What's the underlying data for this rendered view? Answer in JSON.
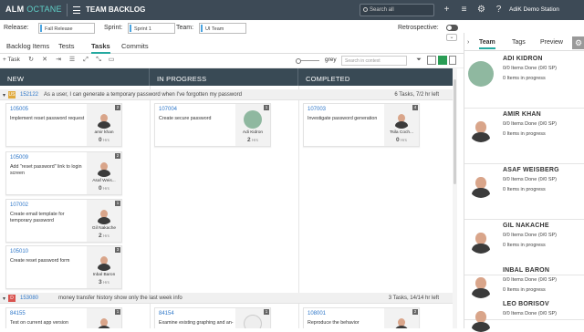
{
  "app": {
    "alm": "ALM",
    "octane": "OCTANE",
    "module": "TEAM BACKLOG",
    "search_placeholder": "Search all",
    "workspace": "AdiK Demo Station"
  },
  "filters": {
    "release_label": "Release:",
    "release_value": "Fall Release",
    "sprint_label": "Sprint:",
    "sprint_value": "Sprint 1",
    "team_label": "Team:",
    "team_value": "UI Team",
    "retro_label": "Retrospective:"
  },
  "tabs": [
    {
      "label": "Backlog Items"
    },
    {
      "label": "Tests"
    },
    {
      "label": "Tasks"
    },
    {
      "label": "Commits"
    }
  ],
  "toolbar": {
    "task_label": "Task",
    "grey_label": "grey",
    "filter_placeholder": "Search in context"
  },
  "columns": [
    {
      "title": "NEW"
    },
    {
      "title": "IN PROGRESS"
    },
    {
      "title": "COMPLETED"
    }
  ],
  "lanes": [
    {
      "badge": "US",
      "id": "152122",
      "desc": "As a user, I can generate a temporary password when I've forgotten my password",
      "tasks": "6 Tasks, 7/2 hr left"
    },
    {
      "badge": "D",
      "id": "153080",
      "desc": "money transfer history show only the last week info",
      "tasks": "3 Tasks, 14/14 hr left"
    }
  ],
  "cards": [
    {
      "id": "105005",
      "desc": "Implement reset password request",
      "num": "2",
      "owner": "amir khan",
      "hours": "0",
      "unit": "Hrs"
    },
    {
      "id": "105009",
      "desc": "Add \"reset password\" link to login screen",
      "num": "2",
      "owner": "Asaf Weis...",
      "hours": "0",
      "unit": "Hrs"
    },
    {
      "id": "107002",
      "desc": "Create email template for temporary password",
      "num": "1",
      "owner": "Gil Nakache",
      "hours": "2",
      "unit": "Hrs"
    },
    {
      "id": "105010",
      "desc": "Create reset password form",
      "num": "3",
      "owner": "Inbal Baron",
      "hours": "3",
      "unit": "Hrs"
    },
    {
      "id": "107004",
      "desc": "Create secure password",
      "num": "1",
      "owner": "Adi Kidron",
      "hours": "2",
      "unit": "Hrs"
    },
    {
      "id": "107003",
      "desc": "Investigate password generation",
      "num": "4",
      "owner": "Tsila Coch...",
      "hours": "0",
      "unit": "Hrs"
    },
    {
      "id": "84155",
      "desc": "Test on current app version",
      "num": "1",
      "owner": "",
      "hours": "",
      "unit": ""
    },
    {
      "id": "84154",
      "desc": "Examine existing graphing and an-",
      "num": "1",
      "owner": "",
      "hours": "",
      "unit": ""
    },
    {
      "id": "108001",
      "desc": "Reproduce the behavior",
      "num": "2",
      "owner": "",
      "hours": "",
      "unit": ""
    }
  ],
  "panel": {
    "tabs": [
      {
        "label": "Team"
      },
      {
        "label": "Tags"
      },
      {
        "label": "Preview"
      }
    ],
    "members": [
      {
        "name": "ADI KIDRON",
        "items": "0/0 Items Done (0/0 SP)",
        "progress": "0 Items in progress"
      },
      {
        "name": "AMIR KHAN",
        "items": "0/0 Items Done (0/0 SP)",
        "progress": "0 Items in progress"
      },
      {
        "name": "ASAF WEISBERG",
        "items": "0/0 Items Done (0/0 SP)",
        "progress": "0 Items in progress"
      },
      {
        "name": "GIL NAKACHE",
        "items": "0/0 Items Done (0/0 SP)",
        "progress": "0 Items in progress"
      },
      {
        "name": "INBAL BARON",
        "items": "0/0 Items Done (0/0 SP)",
        "progress": "0 Items in progress"
      },
      {
        "name": "LEO BORISOV",
        "items": "0/0 Items Done (0/0 SP)",
        "progress": ""
      }
    ]
  },
  "colors": {
    "header": "#3d4a56",
    "column_header": "#394a55",
    "accent": "#25a9a0",
    "link": "#2e77c9",
    "story_badge": "#e0a93b",
    "defect_badge": "#d9534f"
  }
}
